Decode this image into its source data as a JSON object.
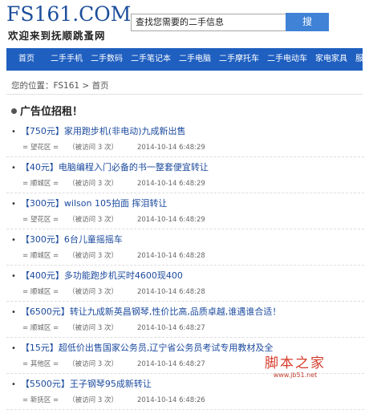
{
  "header": {
    "logo": "FS161.COM",
    "slogan": "欢迎来到抚顺跳蚤网",
    "search_placeholder": "查找您需要的二手信息",
    "search_button": "搜 索"
  },
  "nav": [
    "首页",
    "二手手机",
    "二手数码",
    "二手笔记本",
    "二手电脑",
    "二手摩托车",
    "二手电动车",
    "家电家具",
    "服饰箱包"
  ],
  "breadcrumb": {
    "label": "您的位置：",
    "site": "FS161",
    "sep": ">",
    "current": "首页"
  },
  "section_title": "广告位招租！",
  "listings": [
    {
      "price": "【750元】",
      "title": "家用跑步机(非电动)九成新出售",
      "district": "= 望花区 =",
      "visits": "（被访问 3 次）",
      "time": "2014-10-14 6:48:29"
    },
    {
      "price": "【40元】",
      "title": "电脑编程入门必备的书一整套便宜转让",
      "district": "= 顺城区 =",
      "visits": "（被访问 3 次）",
      "time": "2014-10-14 6:48:29"
    },
    {
      "price": "【300元】",
      "title": "wilson 105拍面 挥泪转让",
      "district": "= 望花区 =",
      "visits": "（被访问 3 次）",
      "time": "2014-10-14 6:48:29"
    },
    {
      "price": "【300元】",
      "title": "6台儿童摇摇车",
      "district": "= 顺城区 =",
      "visits": "（被访问 3 次）",
      "time": "2014-10-14 6:48:28"
    },
    {
      "price": "【400元】",
      "title": "多功能跑步机买时4600现400",
      "district": "= 顺城区 =",
      "visits": "（被访问 3 次）",
      "time": "2014-10-14 6:48:28"
    },
    {
      "price": "【6500元】",
      "title": "转让九成新英昌钢琴,性价比高,品质卓越,谁遇谁合适！",
      "district": "= 顺城区 =",
      "visits": "（被访问 3 次）",
      "time": "2014-10-14 6:48:27"
    },
    {
      "price": "【15元】",
      "title": "超低价出售国家公务员,辽宁省公务员考试专用教材及全",
      "district": "= 其他区 =",
      "visits": "（被访问 3 次）",
      "time": "2014-10-14 6:48:27"
    },
    {
      "price": "【5500元】",
      "title": "王子钢琴95成新转让",
      "district": "= 新抚区 =",
      "visits": "（被访问 3 次）",
      "time": "2014-10-14 6:48:26"
    }
  ],
  "watermark": {
    "main": "脚本之家",
    "sub": "www.jb51.net"
  },
  "colors": {
    "nav_bg": "#1f5fc0",
    "logo": "#1c4e9a",
    "link": "#1b4a9e",
    "search_button": "#3f82d6",
    "watermark": "#d63a2a"
  }
}
